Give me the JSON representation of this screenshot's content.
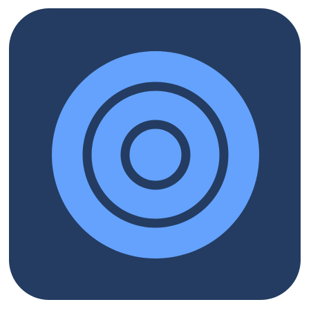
{
  "icon": {
    "name": "target-icon",
    "colors": {
      "tile": "#243c61",
      "rings": "#64a2fe",
      "background": "#ffffff"
    }
  }
}
